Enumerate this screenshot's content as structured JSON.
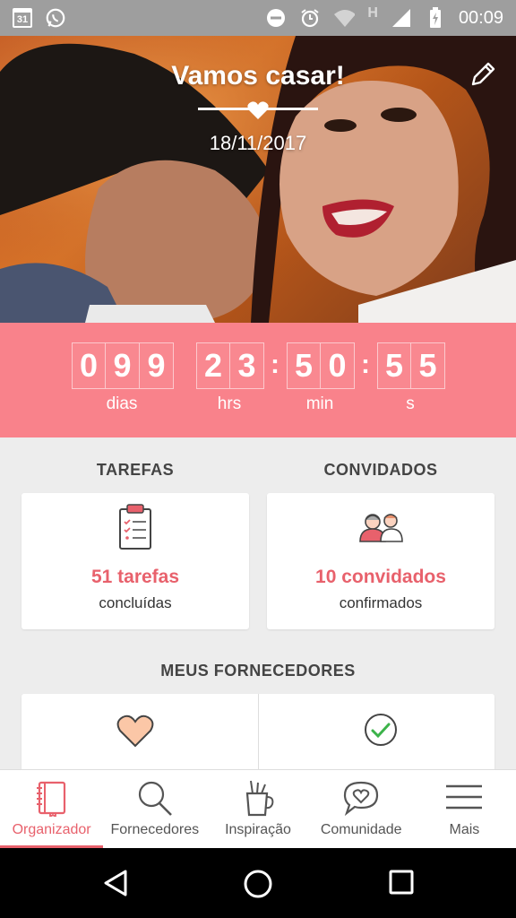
{
  "status_bar": {
    "time": "00:09",
    "calendar_day": "31"
  },
  "hero": {
    "title": "Vamos casar!",
    "date": "18/11/2017"
  },
  "countdown": {
    "groups": [
      {
        "digits": [
          "0",
          "9",
          "9"
        ],
        "label": "dias"
      },
      {
        "digits": [
          "2",
          "3"
        ],
        "label": "hrs"
      },
      {
        "digits": [
          "5",
          "0"
        ],
        "label": "min"
      },
      {
        "digits": [
          "5",
          "5"
        ],
        "label": "s"
      }
    ],
    "separator": ":"
  },
  "tasks": {
    "title": "TAREFAS",
    "count": "51 tarefas",
    "caption": "concluídas"
  },
  "guests": {
    "title": "CONVIDADOS",
    "count": "10 convidados",
    "caption": "confirmados"
  },
  "vendors": {
    "title": "MEUS FORNECEDORES"
  },
  "bottom_nav": {
    "items": [
      {
        "label": "Organizador",
        "icon": "notebook-icon",
        "active": true
      },
      {
        "label": "Fornecedores",
        "icon": "search-icon"
      },
      {
        "label": "Inspiração",
        "icon": "pencil-cup-icon"
      },
      {
        "label": "Comunidade",
        "icon": "heart-chat-icon"
      },
      {
        "label": "Mais",
        "icon": "menu-icon"
      }
    ]
  },
  "colors": {
    "accent": "#e8616c",
    "countdown_bg": "#f9828b",
    "background": "#ededed",
    "status_bar": "#9e9e9e"
  }
}
